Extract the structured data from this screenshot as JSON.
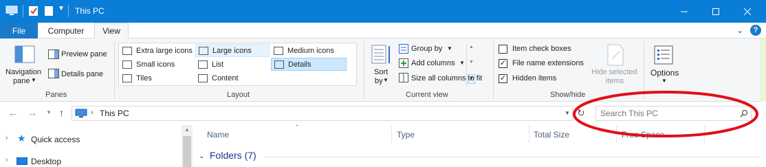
{
  "window": {
    "title": "This PC",
    "minimize_icon": "minimize-icon",
    "maximize_icon": "maximize-icon",
    "close_icon": "close-icon"
  },
  "tabs": {
    "file": "File",
    "computer": "Computer",
    "view": "View"
  },
  "ribbon": {
    "panes": {
      "group_label": "Panes",
      "navigation_pane_line1": "Navigation",
      "navigation_pane_line2": "pane",
      "preview_pane": "Preview pane",
      "details_pane": "Details pane"
    },
    "layout": {
      "group_label": "Layout",
      "items": [
        "Extra large icons",
        "Large icons",
        "Medium icons",
        "Small icons",
        "List",
        "Details",
        "Tiles",
        "Content"
      ],
      "selected": "Details"
    },
    "current_view": {
      "group_label": "Current view",
      "sort_line1": "Sort",
      "sort_line2": "by",
      "group_by": "Group by",
      "add_columns": "Add columns",
      "size_all_columns": "Size all columns to fit"
    },
    "show_hide": {
      "group_label": "Show/hide",
      "item_check_boxes": "Item check boxes",
      "file_name_extensions": "File name extensions",
      "hidden_items": "Hidden items",
      "item_check_boxes_checked": false,
      "file_name_extensions_checked": true,
      "hidden_items_checked": true,
      "hide_selected_line1": "Hide selected",
      "hide_selected_line2": "items"
    },
    "options": "Options"
  },
  "address_bar": {
    "path": "This PC",
    "search_placeholder": "Search This PC"
  },
  "nav_pane": {
    "items": [
      "Quick access",
      "Desktop"
    ]
  },
  "columns": {
    "name": "Name",
    "type": "Type",
    "total_size": "Total Size",
    "free_space": "Free Space"
  },
  "content": {
    "folders_header": "Folders (7)"
  },
  "colors": {
    "titlebar": "#0a7ed6",
    "file_tab": "#1979ca",
    "annotation": "#e0101a"
  }
}
